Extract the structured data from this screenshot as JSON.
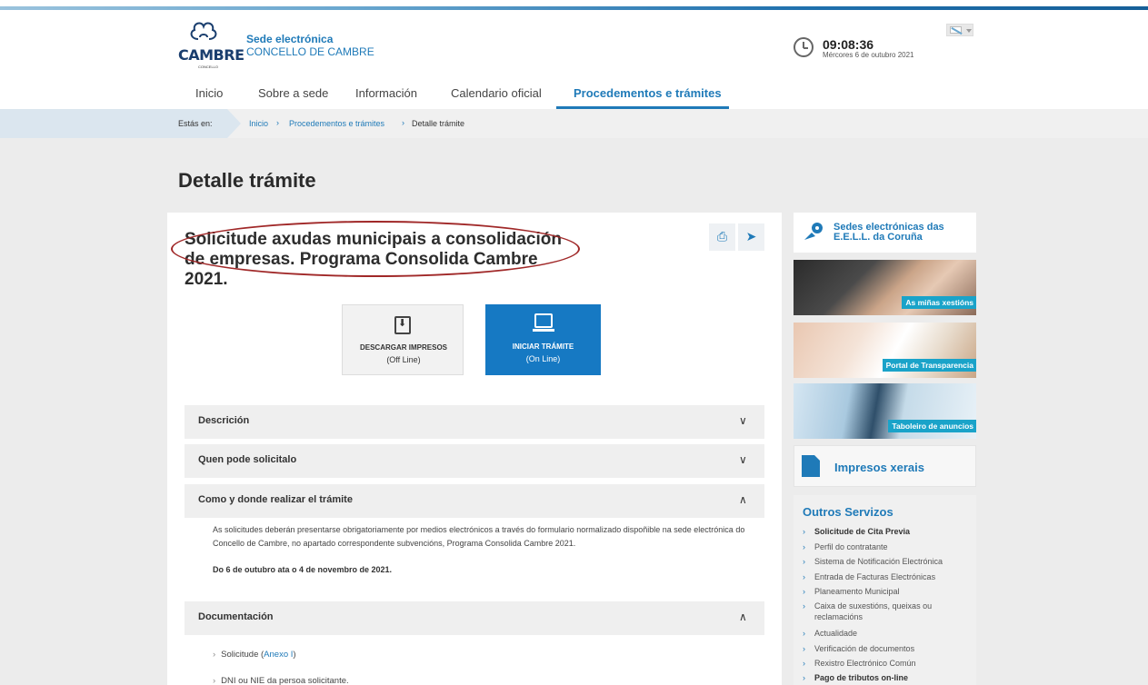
{
  "header": {
    "logo_text": "CAMBRE",
    "logo_sub": "CONCELLO",
    "sede_title": "Sede electrónica",
    "sede_subtitle": "CONCELLO DE CAMBRE",
    "time": "09:08:36",
    "date": "Mércores 6 de outubro 2021"
  },
  "nav": {
    "items": [
      "Inicio",
      "Sobre a sede",
      "Información",
      "Calendario oficial",
      "Procedementos e trámites"
    ],
    "active_index": 4
  },
  "breadcrumb": {
    "label": "Estás en:",
    "items": [
      "Inicio",
      "Procedementos e trámites",
      "Detalle trámite"
    ]
  },
  "page": {
    "title": "Detalle trámite",
    "procedure_name": "Solicitude axudas municipais a consolidación de empresas. Programa Consolida Cambre 2021."
  },
  "actions": {
    "download_label": "DESCARGAR IMPRESOS",
    "download_sub": "(Off Line)",
    "start_label": "INICIAR TRÁMITE",
    "start_sub": "(On Line)"
  },
  "accordion": [
    {
      "label": "Descrición",
      "expanded": false
    },
    {
      "label": "Quen pode solicitalo",
      "expanded": false
    },
    {
      "label": "Como y donde realizar el trámite",
      "expanded": true
    },
    {
      "label": "Documentación",
      "expanded": true
    }
  ],
  "como_body": {
    "text": "As solicitudes deberán presentarse obrigatoriamente por medios electrónicos a través do formulario normalizado dispoñible na sede electrónica do Concello de Cambre, no apartado correspondente subvencións, Programa Consolida Cambre 2021.",
    "dates": "Do 6 de outubro ata o 4 de novembro de 2021."
  },
  "documentacion": {
    "items": [
      {
        "text": "Solicitude (",
        "link": "Anexo I",
        "after": ")"
      },
      {
        "text": "DNI ou NIE da persoa solicitante.",
        "link": "",
        "after": ""
      }
    ]
  },
  "sidebar": {
    "sedes_label": "Sedes electrónicas das E.E.L.L. da Coruña",
    "tiles": [
      "As miñas xestións",
      "Portal de Transparencia",
      "Taboleiro de anuncios"
    ],
    "impresos_label": "Impresos xerais",
    "outros_title": "Outros Servizos",
    "services": [
      "Solicitude de Cita Previa",
      "Perfil do contratante",
      "Sistema de Notificación Electrónica",
      "Entrada de Facturas Electrónicas",
      "Planeamento Municipal",
      "Caixa de suxestións, queixas ou reclamacións",
      "Actualidade",
      "Verificación de documentos",
      "Rexistro Electrónico Común",
      "Pago de tributos on-line"
    ]
  },
  "colors": {
    "accent": "#1f7ab8",
    "primary_button": "#1679c3",
    "highlight_oval": "#a02828",
    "tile_caption": "#1aa3c9"
  }
}
